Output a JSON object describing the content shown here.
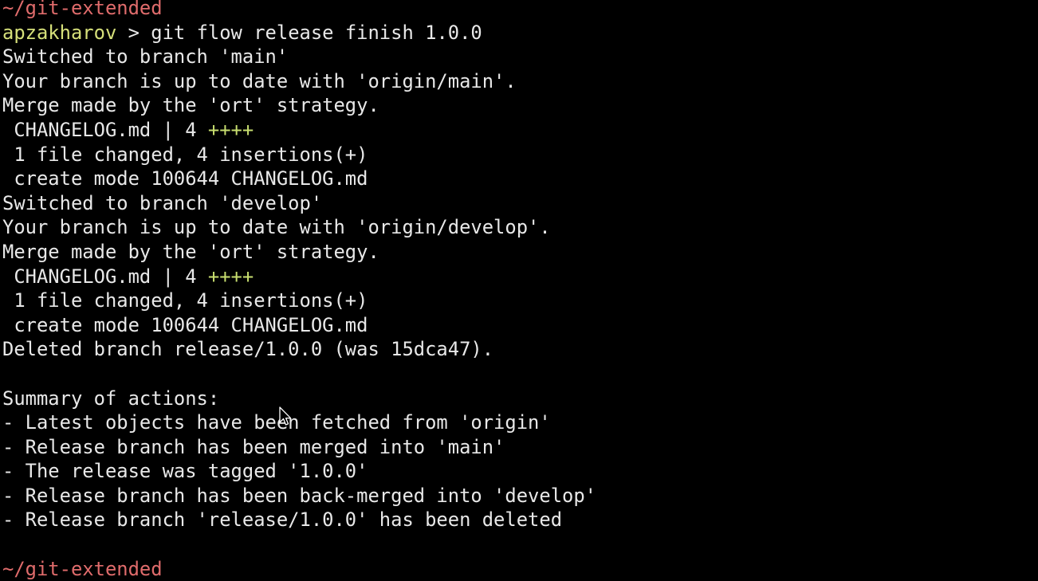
{
  "terminal": {
    "top_path": "~/git-extended",
    "prompt_user": "apzakharov",
    "prompt_symbol": " > ",
    "command": "git flow release finish 1.0.0",
    "output": [
      "Switched to branch 'main'",
      "Your branch is up to date with 'origin/main'.",
      "Merge made by the 'ort' strategy.",
      " CHANGELOG.md | 4 ",
      "++++",
      " 1 file changed, 4 insertions(+)",
      " create mode 100644 CHANGELOG.md",
      "Switched to branch 'develop'",
      "Your branch is up to date with 'origin/develop'.",
      "Merge made by the 'ort' strategy.",
      " CHANGELOG.md | 4 ",
      "++++",
      " 1 file changed, 4 insertions(+)",
      " create mode 100644 CHANGELOG.md",
      "Deleted branch release/1.0.0 (was 15dca47).",
      "",
      "Summary of actions:",
      "- Latest objects have been fetched from 'origin'",
      "- Release branch has been merged into 'main'",
      "- The release was tagged '1.0.0'",
      "- Release branch has been back-merged into 'develop'",
      "- Release branch 'release/1.0.0' has been deleted",
      "",
      "~/git-extended"
    ],
    "colors": {
      "background": "#000000",
      "text": "#e8e8e8",
      "path": "#e06c6c",
      "user": "#d6e07a",
      "insertions": "#c8de6f"
    },
    "icons": {
      "cursor": "mouse-pointer-icon"
    }
  }
}
